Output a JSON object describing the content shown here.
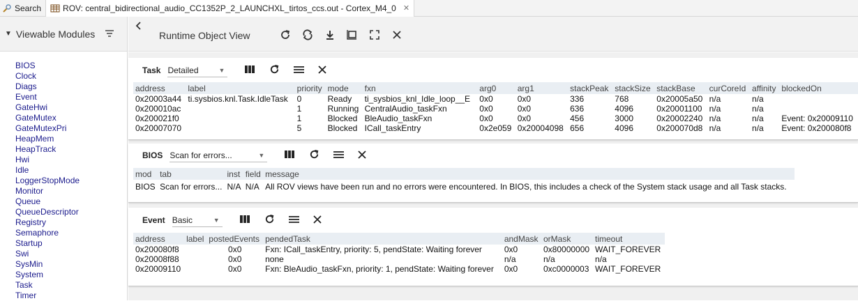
{
  "tabs": {
    "search_label": "Search",
    "rov_label": "ROV: central_bidirectional_audio_CC1352P_2_LAUNCHXL_tirtos_ccs.out - Cortex_M4_0",
    "close_glyph": "✕"
  },
  "sidebar": {
    "title": "Viewable Modules",
    "modules": [
      "BIOS",
      "Clock",
      "Diags",
      "Event",
      "GateHwi",
      "GateMutex",
      "GateMutexPri",
      "HeapMem",
      "HeapTrack",
      "Hwi",
      "Idle",
      "LoggerStopMode",
      "Monitor",
      "Queue",
      "QueueDescriptor",
      "Registry",
      "Semaphore",
      "Startup",
      "Swi",
      "SysMin",
      "System",
      "Task",
      "Timer"
    ]
  },
  "header": {
    "title": "Runtime Object View",
    "icons": [
      "refresh-icon",
      "continuous-refresh-icon",
      "download-icon",
      "snapshot-icon",
      "maximize-icon",
      "close-icon"
    ]
  },
  "task_panel": {
    "name": "Task",
    "view": "Detailed",
    "columns": [
      "address",
      "label",
      "priority",
      "mode",
      "fxn",
      "arg0",
      "arg1",
      "stackPeak",
      "stackSize",
      "stackBase",
      "curCoreId",
      "affinity",
      "blockedOn"
    ],
    "rows": [
      [
        "0x20003a44",
        "ti.sysbios.knl.Task.IdleTask",
        "0",
        "Ready",
        "ti_sysbios_knl_Idle_loop__E",
        "0x0",
        "0x0",
        "336",
        "768",
        "0x20005a50",
        "n/a",
        "n/a",
        ""
      ],
      [
        "0x200010ac",
        "",
        "1",
        "Running",
        "CentralAudio_taskFxn",
        "0x0",
        "0x0",
        "636",
        "4096",
        "0x20001100",
        "n/a",
        "n/a",
        ""
      ],
      [
        "0x200021f0",
        "",
        "1",
        "Blocked",
        "BleAudio_taskFxn",
        "0x0",
        "0x0",
        "456",
        "3000",
        "0x20002240",
        "n/a",
        "n/a",
        "Event: 0x20009110"
      ],
      [
        "0x20007070",
        "",
        "5",
        "Blocked",
        "ICall_taskEntry",
        "0x2e059",
        "0x20004098",
        "656",
        "4096",
        "0x200070d8",
        "n/a",
        "n/a",
        "Event: 0x200080f8"
      ]
    ]
  },
  "bios_panel": {
    "name": "BIOS",
    "view": "Scan for errors...",
    "columns": [
      "mod",
      "tab",
      "inst",
      "field",
      "message"
    ],
    "rows": [
      [
        "BIOS",
        "Scan for errors...",
        "N/A",
        "N/A",
        "All ROV views have been run and no errors were encountered. In BIOS, this includes a check of the System stack usage and all Task stacks."
      ]
    ]
  },
  "event_panel": {
    "name": "Event",
    "view": "Basic",
    "columns": [
      "address",
      "label",
      "postedEvents",
      "pendedTask",
      "andMask",
      "orMask",
      "timeout"
    ],
    "rows": [
      [
        "0x200080f8",
        "",
        "0x0",
        "Fxn: ICall_taskEntry, priority: 5, pendState: Waiting forever",
        "0x0",
        "0x80000000",
        "WAIT_FOREVER"
      ],
      [
        "0x20008f88",
        "",
        "0x0",
        "none",
        "n/a",
        "n/a",
        "n/a"
      ],
      [
        "0x20009110",
        "",
        "0x0",
        "Fxn: BleAudio_taskFxn, priority: 1, pendState: Waiting forever",
        "0x0",
        "0xc0000003",
        "WAIT_FOREVER"
      ]
    ]
  },
  "colors": {
    "module_link": "#1a1a8c",
    "header_bg": "#f2f2f2",
    "table_header_bg": "#e9eef3"
  }
}
